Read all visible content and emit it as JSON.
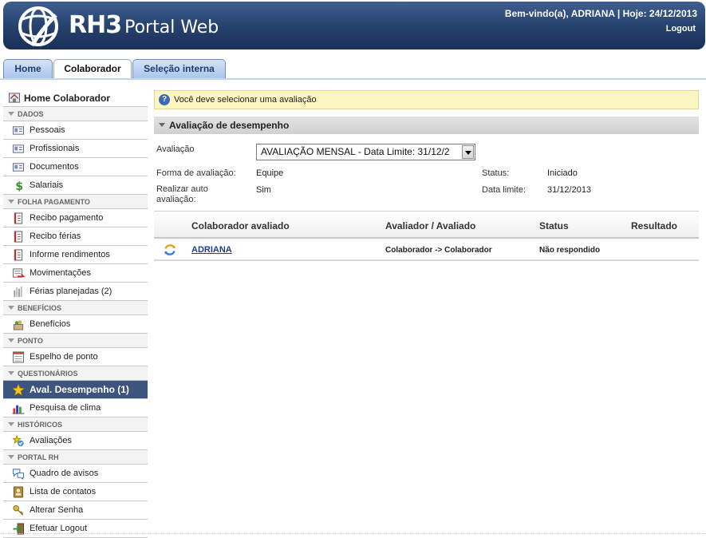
{
  "header": {
    "brand": "RH3",
    "brand_sub": "Portal Web",
    "welcome": "Bem-vindo(a), ADRIANA | Hoje: 24/12/2013",
    "logout": "Logout"
  },
  "tabs": [
    {
      "label": "Home",
      "active": false
    },
    {
      "label": "Colaborador",
      "active": true
    },
    {
      "label": "Seleção interna",
      "active": false
    }
  ],
  "sidebar": {
    "home": "Home Colaborador",
    "sections": [
      {
        "title": "DADOS",
        "items": [
          "Pessoais",
          "Profissionais",
          "Documentos",
          "Salariais"
        ]
      },
      {
        "title": "FOLHA PAGAMENTO",
        "items": [
          "Recibo pagamento",
          "Recibo férias",
          "Informe rendimentos",
          "Movimentações",
          "Férias planejadas (2)"
        ]
      },
      {
        "title": "BENEFÍCIOS",
        "items": [
          "Benefícios"
        ]
      },
      {
        "title": "PONTO",
        "items": [
          "Espelho de ponto"
        ]
      },
      {
        "title": "QUESTIONÁRIOS",
        "items": [
          "Aval. Desempenho (1)",
          "Pesquisa de clima"
        ]
      },
      {
        "title": "HISTÓRICOS",
        "items": [
          "Avaliações"
        ]
      },
      {
        "title": "PORTAL RH",
        "items": [
          "Quadro de avisos",
          "Lista de contatos",
          "Alterar Senha",
          "Efetuar Logout"
        ]
      }
    ],
    "active_item": "Aval. Desempenho (1)"
  },
  "notice": "Você deve selecionar uma avaliação",
  "panel": {
    "title": "Avaliação de desempenho",
    "avaliacao_label": "Avaliação",
    "avaliacao_value": "AVALIAÇÃO MENSAL - Data Limite: 31/12/2",
    "forma_label": "Forma de avaliação:",
    "forma_value": "Equipe",
    "auto_label_1": "Realizar auto",
    "auto_label_2": "avaliação:",
    "auto_value": "Sim",
    "status_label": "Status:",
    "status_value": "Iniciado",
    "data_label": "Data limite:",
    "data_value": "31/12/2013"
  },
  "grid": {
    "headers": [
      "Colaborador avaliado",
      "Avaliador / Avaliado",
      "Status",
      "Resultado"
    ],
    "rows": [
      {
        "colaborador": "ADRIANA",
        "avaliador": "Colaborador -> Colaborador",
        "status": "Não respondido",
        "resultado": ""
      }
    ]
  },
  "colors": {
    "header_bg": "#24406c",
    "active_nav": "#3d557e",
    "notice_bg": "#fdf6c3",
    "link": "#1a3f8c"
  }
}
